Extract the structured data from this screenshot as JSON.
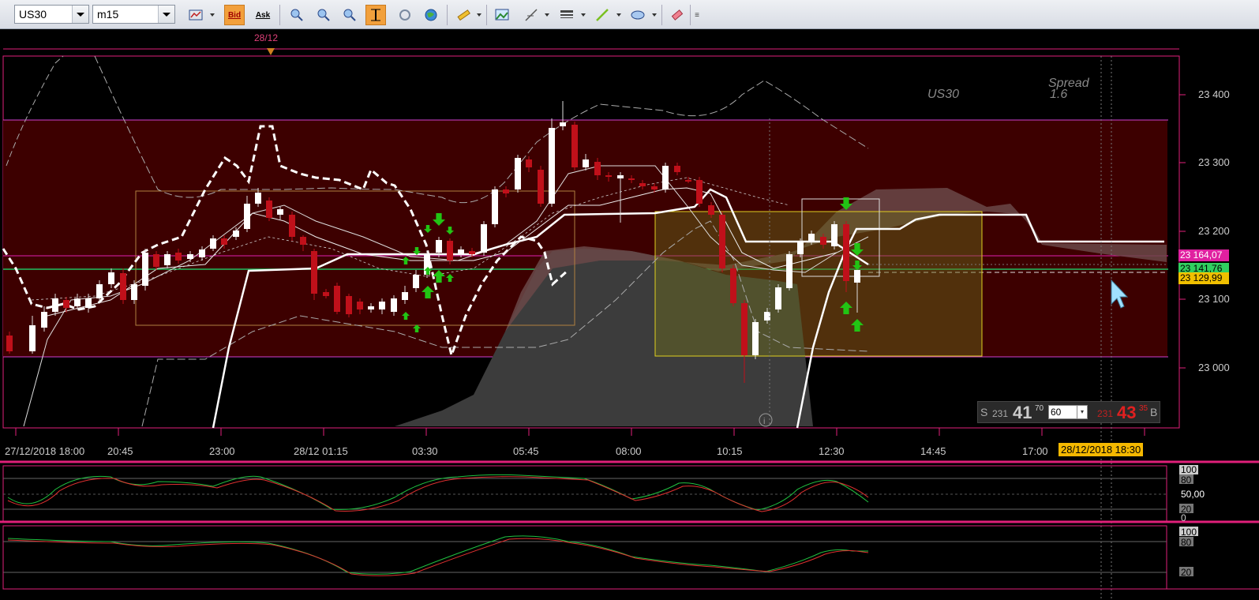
{
  "toolbar": {
    "symbol": "US30",
    "timeframe": "m15",
    "bid_label": "Bid",
    "ask_label": "Ask"
  },
  "chart": {
    "symbol_label": "US30",
    "spread_label": "Spread",
    "spread_value": "1.6",
    "date_marker": "28/12",
    "price_axis": [
      "23 400",
      "23 300",
      "23 200",
      "23 100",
      "23 000"
    ],
    "time_axis": [
      "27/12/2018 18:00",
      "20:45",
      "23:00",
      "28/12 01:15",
      "03:30",
      "05:45",
      "08:00",
      "10:15",
      "12:30",
      "14:45",
      "17:00"
    ],
    "current_time": "28/12/2018 18:30",
    "price_tags": {
      "magenta": "23 164,07",
      "green": "23 141,76",
      "yellow": "23 129,99"
    },
    "colors": {
      "bull": "#ffffff",
      "bear": "#c0101a",
      "band": "#3d0000",
      "accent": "#e0207a",
      "buy_arrow": "#22c414"
    }
  },
  "trade_panel": {
    "sell_label": "S",
    "sell_prefix": "231",
    "sell_big": "41",
    "sell_sup": "70",
    "lot": "60",
    "buy_prefix": "231",
    "buy_big": "43",
    "buy_sup": "35",
    "buy_label": "B"
  },
  "oscillator1": {
    "levels": [
      "100",
      "80",
      "50,00",
      "20",
      "0"
    ]
  },
  "oscillator2": {
    "levels": [
      "100",
      "80",
      "20"
    ]
  }
}
